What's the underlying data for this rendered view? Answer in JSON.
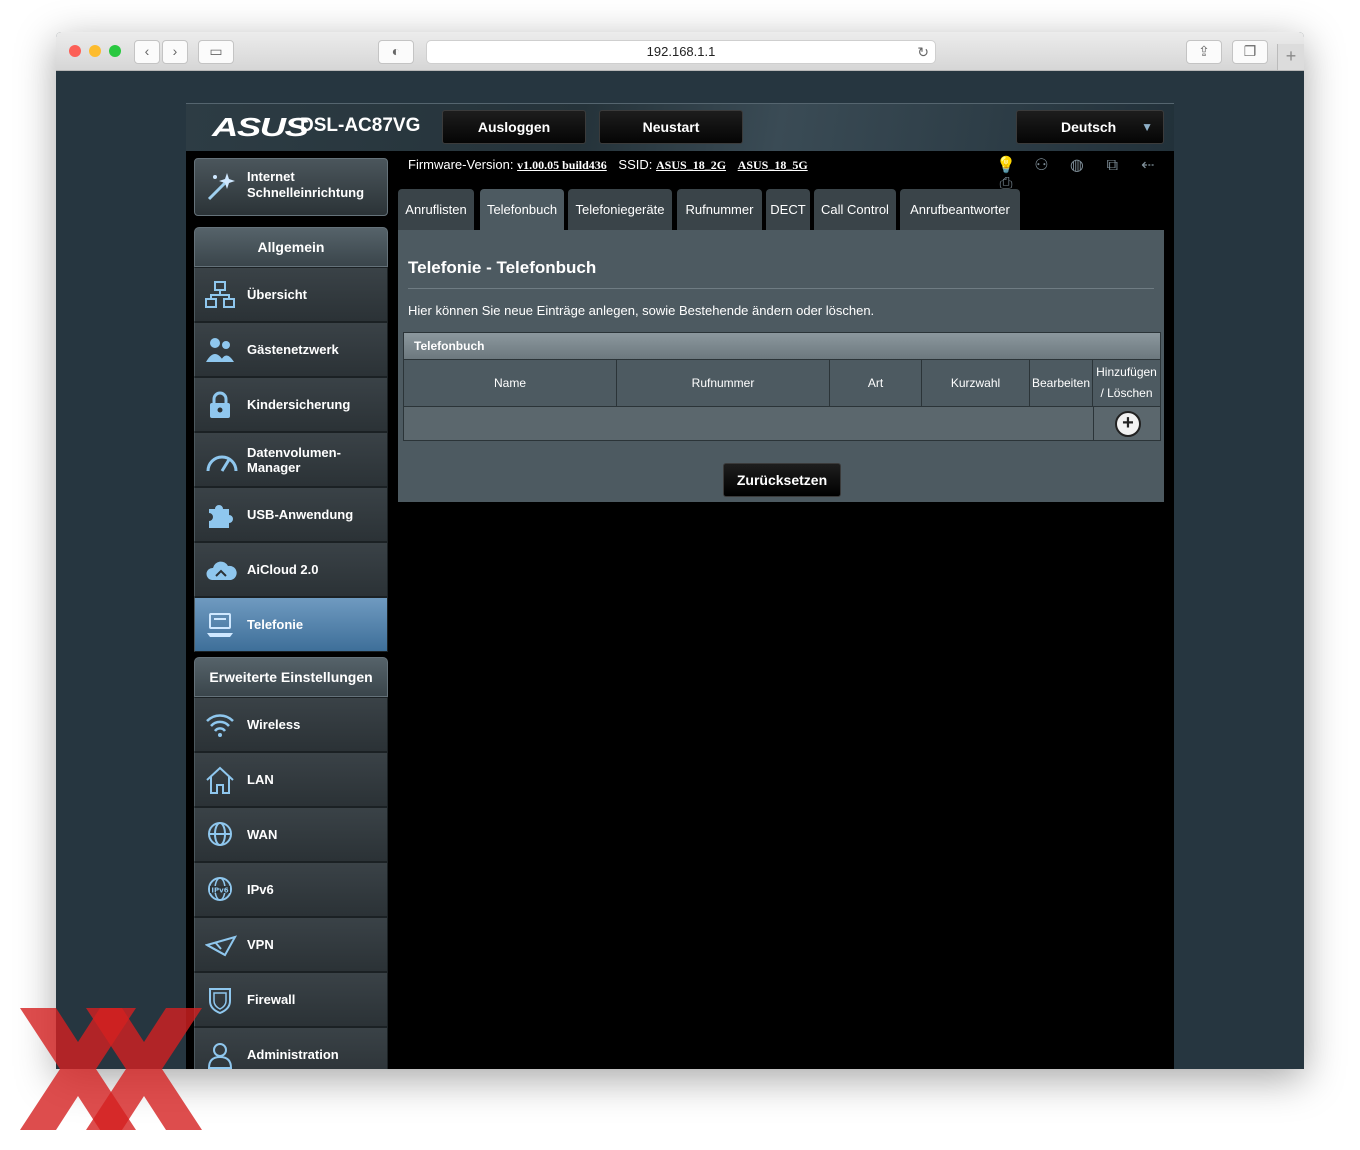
{
  "browser": {
    "url": "192.168.1.1"
  },
  "header": {
    "logo": "ASUS",
    "model": "DSL-AC87VG",
    "logout": "Ausloggen",
    "reboot": "Neustart",
    "language": "Deutsch"
  },
  "sidebar": {
    "quick_setup": [
      "Internet",
      "Schnelleinrichtung"
    ],
    "general_title": "Allgemein",
    "general": [
      {
        "label": "Übersicht",
        "icon": "network-map-icon"
      },
      {
        "label": "Gästenetzwerk",
        "icon": "guest-network-icon"
      },
      {
        "label": "Kindersicherung",
        "icon": "lock-icon"
      },
      {
        "label": "Datenvolumen-Manager",
        "icon": "gauge-icon"
      },
      {
        "label": "USB-Anwendung",
        "icon": "puzzle-icon"
      },
      {
        "label": "AiCloud 2.0",
        "icon": "cloud-icon"
      },
      {
        "label": "Telefonie",
        "icon": "phone-icon",
        "active": true
      }
    ],
    "advanced_title": "Erweiterte Einstellungen",
    "advanced": [
      {
        "label": "Wireless",
        "icon": "wifi-icon"
      },
      {
        "label": "LAN",
        "icon": "home-icon"
      },
      {
        "label": "WAN",
        "icon": "globe-icon"
      },
      {
        "label": "IPv6",
        "icon": "ipv6-icon"
      },
      {
        "label": "VPN",
        "icon": "vpn-icon"
      },
      {
        "label": "Firewall",
        "icon": "shield-icon"
      },
      {
        "label": "Administration",
        "icon": "admin-icon"
      }
    ]
  },
  "info": {
    "firmware_label": "Firmware-Version:",
    "firmware": "v1.00.05 build436",
    "ssid_label": "SSID:",
    "ssid_2g": "ASUS_18_2G",
    "ssid_5g": "ASUS_18_5G"
  },
  "tabs": [
    "Anruflisten",
    "Telefonbuch",
    "Telefoniegeräte",
    "Rufnummer",
    "DECT",
    "Call Control",
    "Anrufbeantworter"
  ],
  "active_tab": "Telefonbuch",
  "panel": {
    "title": "Telefonie - Telefonbuch",
    "description": "Hier können Sie neue Einträge anlegen, sowie Bestehende ändern oder löschen.",
    "table_title": "Telefonbuch",
    "columns": [
      "Name",
      "Rufnummer",
      "Art",
      "Kurzwahl",
      "Bearbeiten",
      "Hinzufügen / Löschen"
    ],
    "add_symbol": "+",
    "reset_button": "Zurücksetzen"
  },
  "colors": {
    "accent": "#4a7ba6",
    "panel": "#4d5a61",
    "background": "#263640"
  }
}
